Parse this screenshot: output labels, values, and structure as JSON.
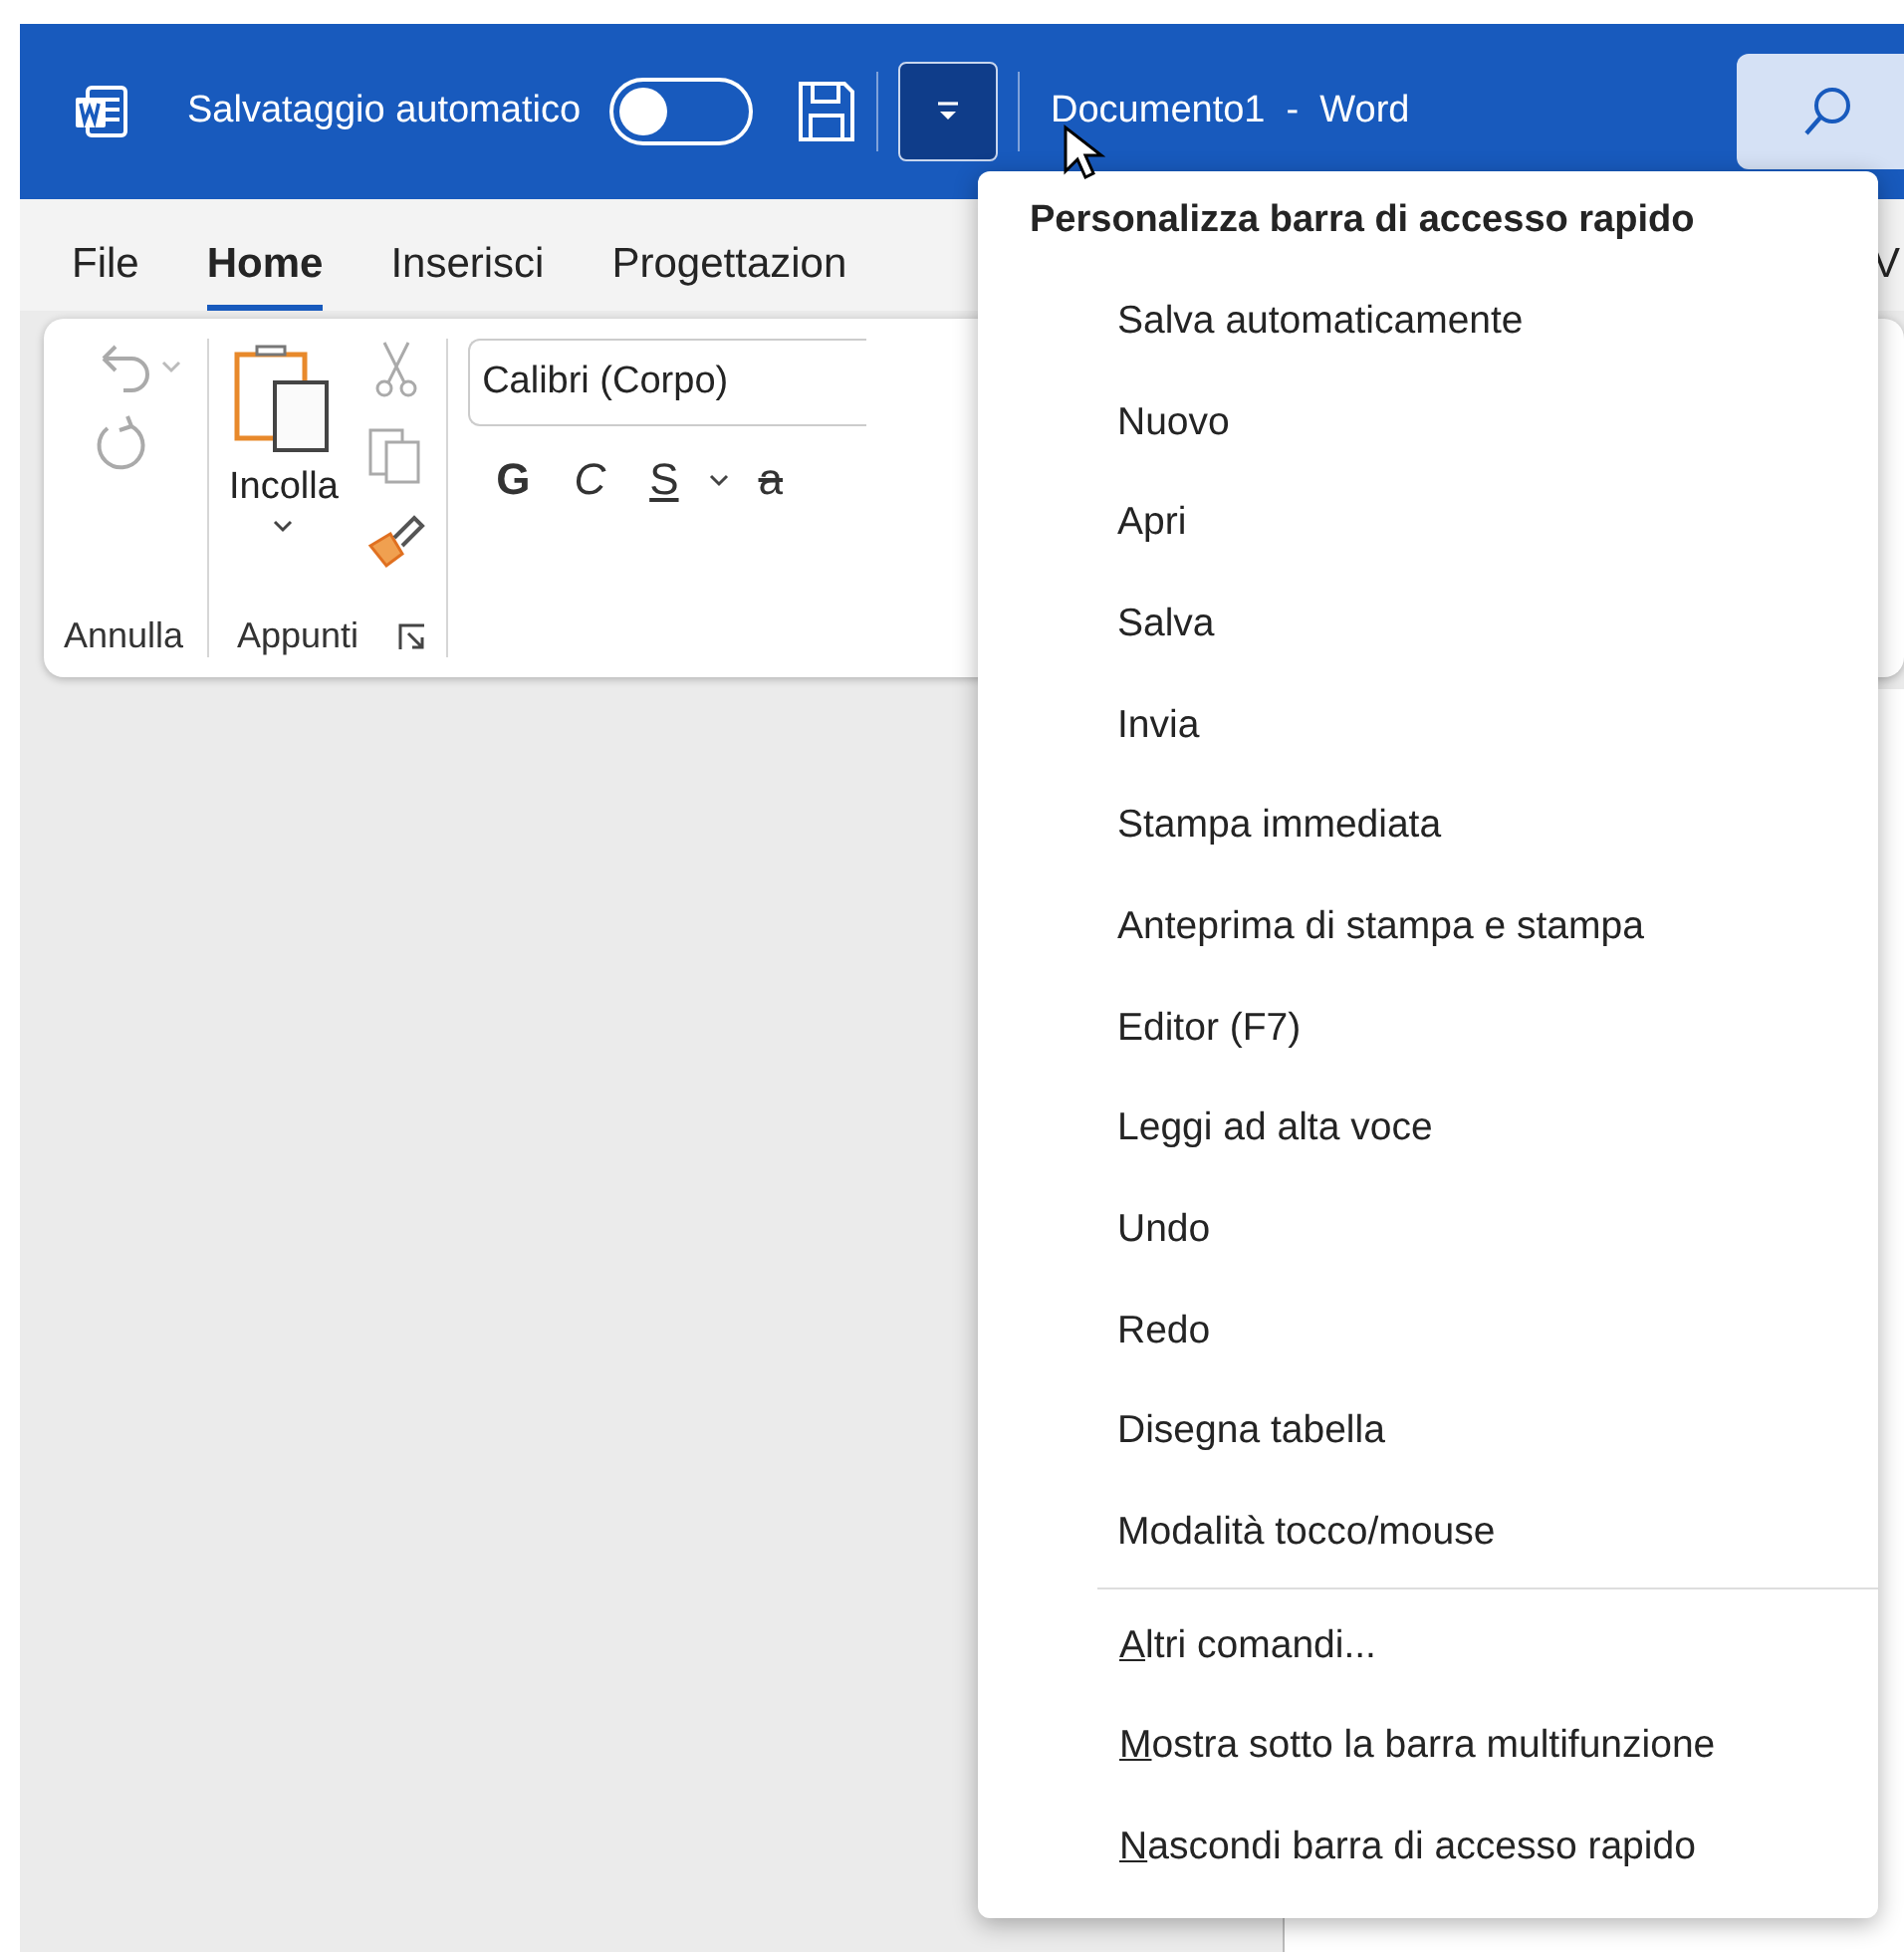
{
  "title_bar": {
    "autosave_label": "Salvataggio automatico",
    "autosave_on": false,
    "customize_pressed": true,
    "document_title": "Documento1  -  Word"
  },
  "tabs": [
    {
      "label": "File",
      "selected": false
    },
    {
      "label": "Home",
      "selected": true
    },
    {
      "label": "Inserisci",
      "selected": false
    },
    {
      "label": "Progettazion",
      "selected": false
    },
    {
      "label": "V",
      "selected": false
    }
  ],
  "ribbon": {
    "undo_group": {
      "label": "Annulla"
    },
    "clipboard_group": {
      "label": "Appunti",
      "paste_label": "Incolla"
    },
    "font_group": {
      "font_name": "Calibri (Corpo)",
      "format_buttons": [
        {
          "label": "G",
          "kind": "bold"
        },
        {
          "label": "C",
          "kind": "italic"
        },
        {
          "label": "S",
          "kind": "underline"
        },
        {
          "label": "a",
          "kind": "strike"
        }
      ]
    }
  },
  "menu": {
    "title": "Personalizza barra di accesso rapido",
    "items": [
      {
        "label": "Salva automaticamente",
        "kind": "command"
      },
      {
        "label": "Nuovo",
        "kind": "command"
      },
      {
        "label": "Apri",
        "kind": "command"
      },
      {
        "label": "Salva",
        "kind": "command"
      },
      {
        "label": "Invia",
        "kind": "command"
      },
      {
        "label": "Stampa immediata",
        "kind": "command"
      },
      {
        "label": "Anteprima di stampa e stampa",
        "kind": "command"
      },
      {
        "label": "Editor (F7)",
        "kind": "command"
      },
      {
        "label": "Leggi ad alta voce",
        "kind": "command"
      },
      {
        "label": "Undo",
        "kind": "command"
      },
      {
        "label": "Redo",
        "kind": "command"
      },
      {
        "label": "Disegna tabella",
        "kind": "command"
      },
      {
        "label": "Modalità tocco/mouse",
        "kind": "command"
      },
      {
        "label": "Altri comandi...",
        "kind": "action",
        "accelerator": true
      },
      {
        "label": "Mostra sotto la barra multifunzione",
        "kind": "action",
        "accelerator": true
      },
      {
        "label": "Nascondi barra di accesso rapido",
        "kind": "action",
        "accelerator": true
      }
    ]
  }
}
